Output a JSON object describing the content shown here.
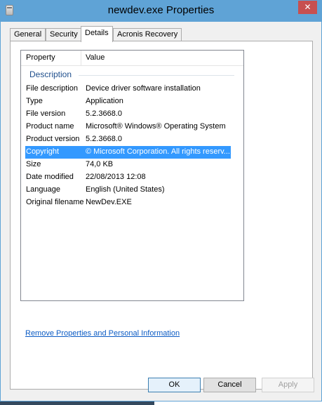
{
  "window": {
    "title": "newdev.exe Properties",
    "close_glyph": "✕",
    "icon": "file-icon",
    "accent_color": "#5fa3d6"
  },
  "tabs": [
    {
      "label": "General"
    },
    {
      "label": "Security"
    },
    {
      "label": "Details",
      "active": true
    },
    {
      "label": "Acronis Recovery"
    }
  ],
  "details": {
    "columns": {
      "property": "Property",
      "value": "Value"
    },
    "group": "Description",
    "rows": [
      {
        "property": "File description",
        "value": "Device driver software installation"
      },
      {
        "property": "Type",
        "value": "Application"
      },
      {
        "property": "File version",
        "value": "5.2.3668.0"
      },
      {
        "property": "Product name",
        "value": "Microsoft® Windows® Operating System"
      },
      {
        "property": "Product version",
        "value": "5.2.3668.0"
      },
      {
        "property": "Copyright",
        "value": "© Microsoft Corporation. All rights reserv...",
        "selected": true
      },
      {
        "property": "Size",
        "value": "74,0 KB"
      },
      {
        "property": "Date modified",
        "value": "22/08/2013 12:08"
      },
      {
        "property": "Language",
        "value": "English (United States)"
      },
      {
        "property": "Original filename",
        "value": "NewDev.EXE"
      }
    ]
  },
  "link": {
    "label": "Remove Properties and Personal Information"
  },
  "buttons": {
    "ok": "OK",
    "cancel": "Cancel",
    "apply": "Apply"
  }
}
